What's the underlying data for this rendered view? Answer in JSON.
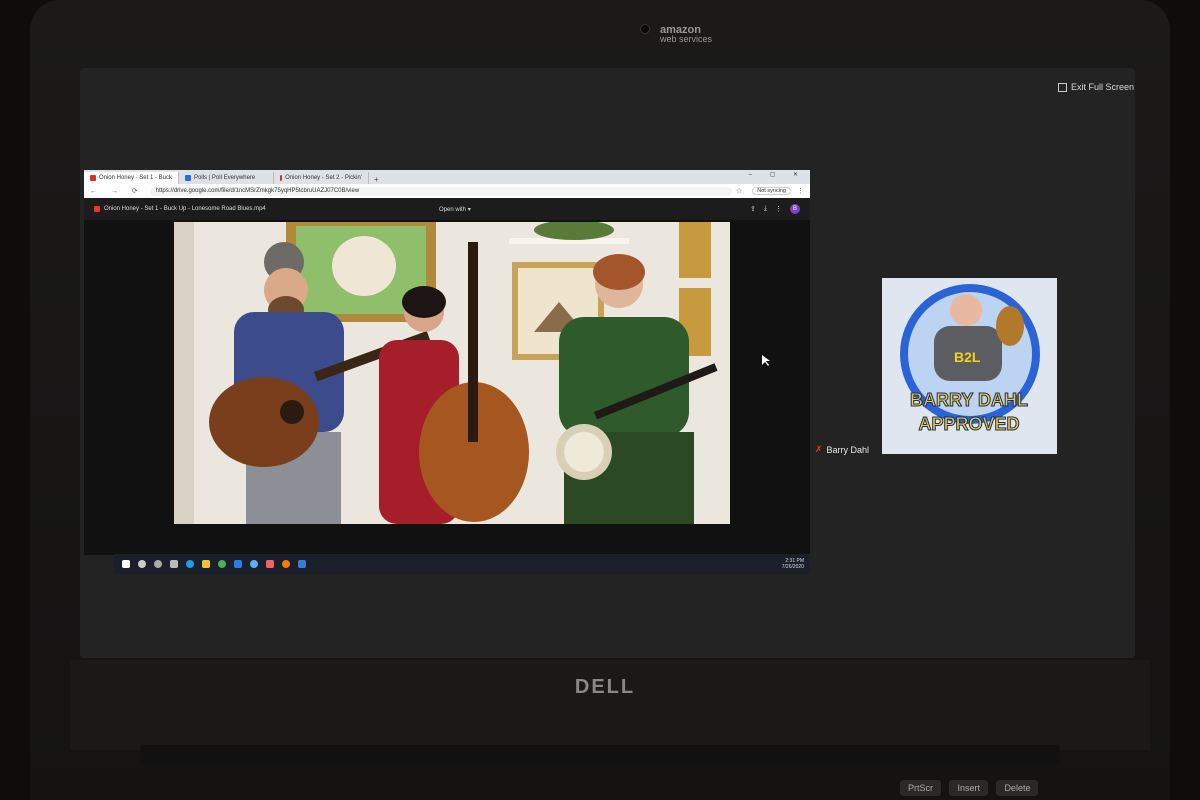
{
  "branding": {
    "laptop_logo": "DELL",
    "aws_label_line1": "amazon",
    "aws_label_line2": "web services"
  },
  "meeting": {
    "exit_fullscreen_label": "Exit Full Screen",
    "participant_name": "Barry Dahl",
    "participant_badge_line1": "BARRY DAHL",
    "participant_badge_line2": "APPROVED",
    "participant_shirt_text": "B2L"
  },
  "browser": {
    "tabs": [
      {
        "label": "Onion Honey - Set 1 - Buck",
        "color": "#d93025"
      },
      {
        "label": "Polls | Poll Everywhere",
        "color": "#1a73e8"
      },
      {
        "label": "Onion Honey - Set 2 - Pickin'",
        "color": "#d93025"
      }
    ],
    "url": "https://drive.google.com/file/d/1ncMSrZmkgk75yqHP5tcbruUAZJ07C0B/view",
    "sync_label": "Not syncing",
    "drive_file_name": "Onion Honey - Set 1 - Buck Up - Lonesome Road Blues.mp4",
    "open_with_label": "Open with",
    "avatar_initial": "B"
  },
  "taskbar": {
    "time": "2:31 PM",
    "date": "7/26/2020"
  },
  "keyboard": {
    "keys": [
      "PrtScr",
      "Insert",
      "Delete"
    ]
  },
  "colors": {
    "badge_text": "#f2d21a",
    "badge_circle": "#2a63d6"
  }
}
